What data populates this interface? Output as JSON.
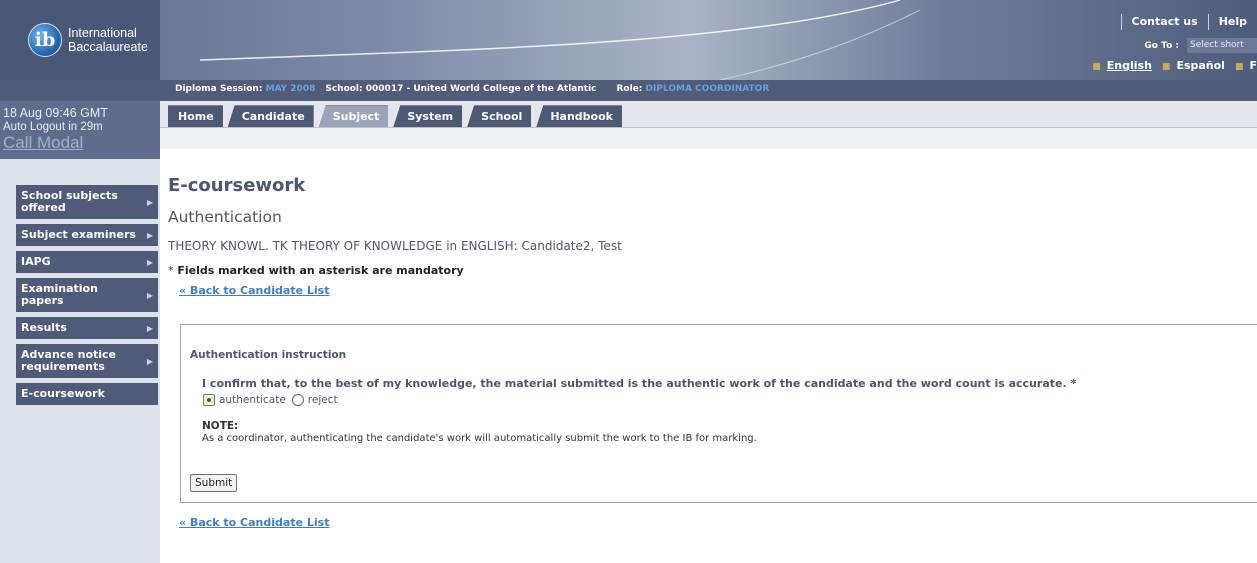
{
  "header": {
    "logo_glyph": "ib",
    "logo_line1": "International",
    "logo_line2": "Baccalaureate",
    "top_links": [
      "Contact us",
      "Help"
    ],
    "goto_label": "Go To :",
    "goto_value": "Select short",
    "languages": [
      "English",
      "Español",
      "F"
    ]
  },
  "session": {
    "session_label": "Diploma Session:",
    "session_value": "MAY 2008",
    "school_label": "School:",
    "school_value": "000017 - United World College of the Atlantic",
    "role_label": "Role:",
    "role_value": "DIPLOMA COORDINATOR"
  },
  "status": {
    "clock": "18 Aug 09:46 GMT",
    "auto_logout": "Auto Logout in 29m",
    "call_modal": "Call Modal"
  },
  "tabs": [
    "Home",
    "Candidate",
    "Subject",
    "System",
    "School",
    "Handbook"
  ],
  "active_tab": "Subject",
  "side_menu": [
    {
      "label": "School subjects offered",
      "arrow": "▶"
    },
    {
      "label": "Subject examiners",
      "arrow": "▶"
    },
    {
      "label": "IAPG",
      "arrow": "▶"
    },
    {
      "label": "Examination papers",
      "arrow": "▶"
    },
    {
      "label": "Results",
      "arrow": "▶"
    },
    {
      "label": "Advance notice requirements",
      "arrow": "▶"
    },
    {
      "label": "E-coursework",
      "arrow": ""
    }
  ],
  "main": {
    "title": "E-coursework",
    "subtitle": "Authentication",
    "candidate_line": "THEORY KNOWL. TK THEORY OF KNOWLEDGE in ENGLISH: Candidate2, Test",
    "mandatory_star": "*",
    "mandatory_text": "Fields marked with an asterisk are mandatory",
    "back_link": "« Back to Candidate List",
    "box_title": "Authentication instruction",
    "confirm_text": "I confirm that, to the best of my knowledge, the material submitted is the authentic work of the candidate and the word count is accurate. *",
    "radio_authenticate": "authenticate",
    "radio_reject": "reject",
    "note_heading": "NOTE:",
    "note_text": "As a coordinator, authenticating the candidate's work will automatically submit the work to the IB for marking.",
    "submit_label": "Submit"
  },
  "colors": {
    "header_dark": "#4a5878",
    "tab_bg": "#4d5874",
    "tab_active": "#9aa3b8",
    "link_blue": "#3e7fc4",
    "highlight_blue": "#6aa0e6"
  }
}
